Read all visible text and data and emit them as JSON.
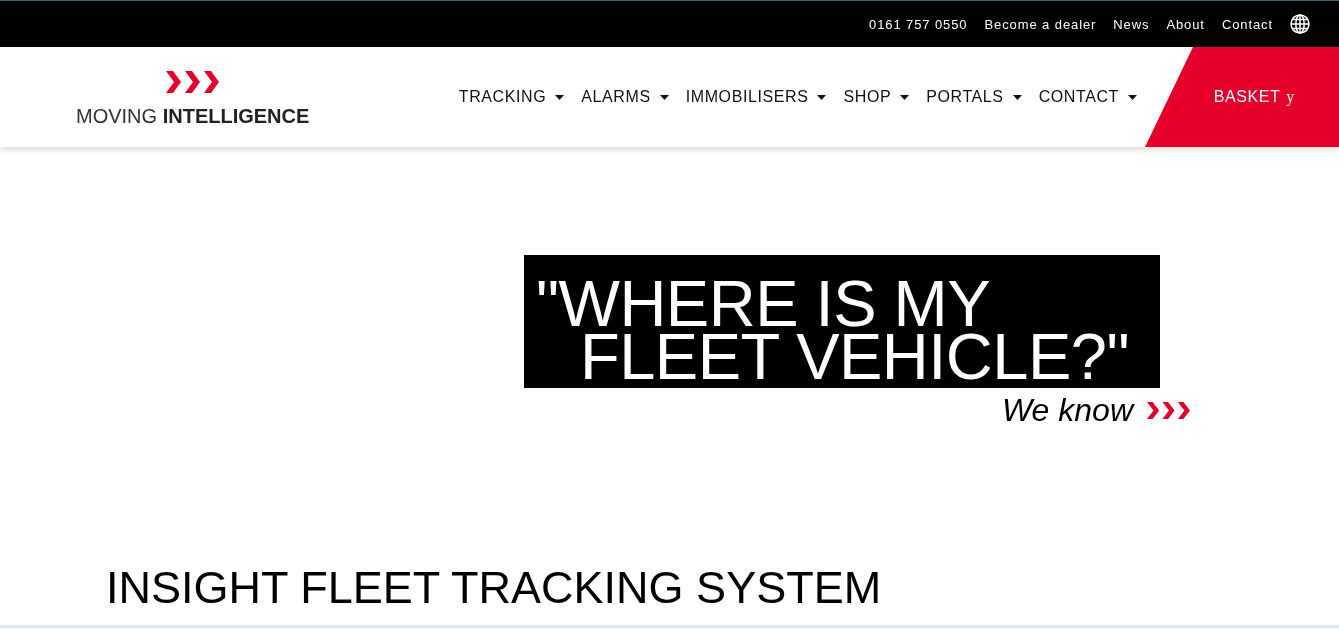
{
  "top_bar": {
    "phone": "0161 757 0550",
    "links": [
      {
        "label": "Become a dealer"
      },
      {
        "label": "News"
      },
      {
        "label": "About"
      },
      {
        "label": "Contact"
      }
    ]
  },
  "header": {
    "logo": "MOVING **INTELLIGENCE**",
    "nav": [
      {
        "label": "TRACKING"
      },
      {
        "label": "ALARMS"
      },
      {
        "label": "IMMOBILISERS"
      },
      {
        "label": "SHOP"
      },
      {
        "label": "PORTALS"
      },
      {
        "label": "CONTACT"
      }
    ],
    "basket": {
      "label": "BASKET",
      "glyph": "y"
    }
  },
  "hero": {
    "quote_lines": [
      "\"WHERE IS MY",
      "FLEET VEHICLE?\""
    ],
    "tagline": "We know"
  },
  "heading": "INSIGHT FLEET TRACKING SYSTEM"
}
